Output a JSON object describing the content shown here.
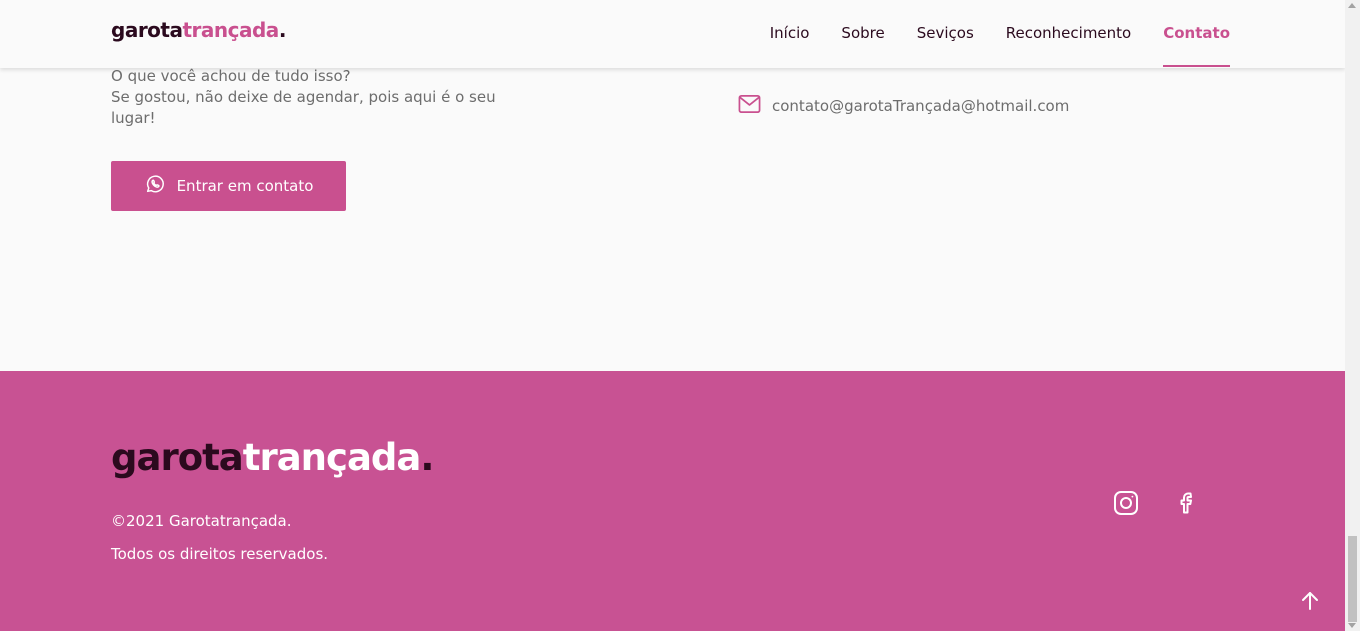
{
  "header": {
    "logo_part1": "garota",
    "logo_part2": "trançada",
    "logo_dot": ".",
    "nav": [
      "Início",
      "Sobre",
      "Seviços",
      "Reconhecimento",
      "Contato"
    ],
    "active_nav": "Contato"
  },
  "contact": {
    "line1": "O que você achou de tudo isso?",
    "line2": "Se gostou, não deixe de agendar, pois aqui é o seu lugar!",
    "cta_label": "Entrar em contato",
    "email": "contato@garotaTrançada@hotmail.com"
  },
  "footer": {
    "logo_part1": "garota",
    "logo_part2": "trançada",
    "logo_dot": ".",
    "copyright": "©2021 Garotatrançada.",
    "rights": "Todos os direitos reservados."
  },
  "icons": {
    "cta": "whatsapp-icon",
    "email": "mail-icon",
    "social": [
      "instagram-icon",
      "facebook-icon"
    ],
    "back_to_top": "arrow-up-icon"
  },
  "colors": {
    "accent": "#c9508f",
    "footer_bg": "#c85293",
    "dark": "#2b0a1e",
    "muted_text": "#6d6d6d",
    "page_bg": "#fafafa"
  }
}
